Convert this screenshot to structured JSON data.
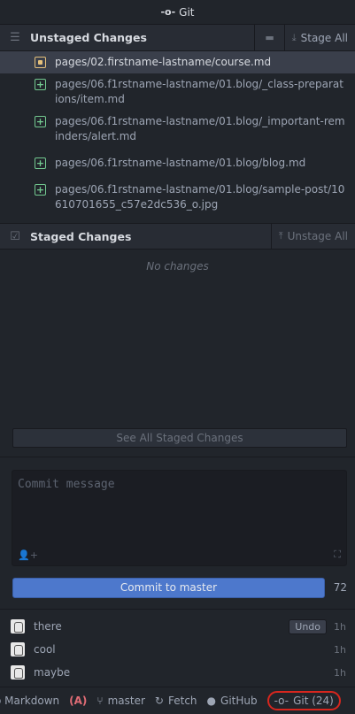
{
  "title": "Git",
  "unstaged": {
    "header": "Unstaged Changes",
    "stage_all": "Stage All",
    "files": [
      {
        "path": "pages/02.firstname-lastname/course.md",
        "status": "modified"
      },
      {
        "path": "pages/06.f1rstname-lastname/01.blog/_class-preparations/item.md",
        "status": "added"
      },
      {
        "path": "pages/06.f1rstname-lastname/01.blog/_important-reminders/alert.md",
        "status": "added"
      },
      {
        "path": "pages/06.f1rstname-lastname/01.blog/blog.md",
        "status": "added"
      },
      {
        "path": "pages/06.f1rstname-lastname/01.blog/sample-post/10610701655_c57e2dc536_o.jpg",
        "status": "added"
      }
    ]
  },
  "staged": {
    "header": "Staged Changes",
    "unstage_all": "Unstage All",
    "empty_text": "No changes",
    "see_all": "See All Staged Changes"
  },
  "commit": {
    "placeholder": "Commit message",
    "button": "Commit to master",
    "remaining": "72"
  },
  "recent_commits": [
    {
      "message": "there",
      "time": "1h",
      "undo": "Undo"
    },
    {
      "message": "cool",
      "time": "1h"
    },
    {
      "message": "maybe",
      "time": "1h"
    }
  ],
  "statusbar": {
    "markdown": "o Markdown",
    "branch": "master",
    "fetch": "Fetch",
    "github": "GitHub",
    "git": "Git (24)"
  }
}
